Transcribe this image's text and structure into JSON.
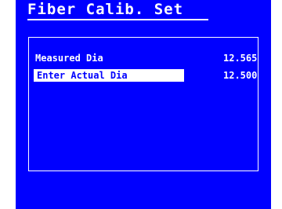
{
  "title": "Fiber Calib. Set",
  "rows": [
    {
      "label": "Measured Dia",
      "value": "12.565"
    },
    {
      "label": "Enter Actual Dia",
      "value": "12.500"
    }
  ],
  "colors": {
    "background": "#0000ff",
    "foreground": "#ffffff",
    "highlight": "#ffffff"
  }
}
